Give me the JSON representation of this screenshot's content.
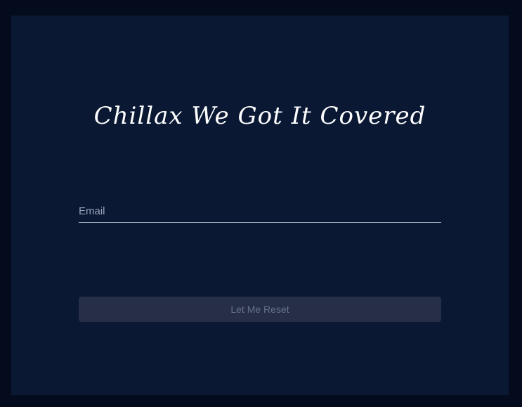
{
  "form": {
    "title": "Chillax We Got It Covered",
    "email_placeholder": "Email",
    "email_value": "",
    "submit_label": "Let Me Reset"
  },
  "colors": {
    "outer_background": "#030b1c",
    "panel_background": "#0a1834",
    "title_text": "#ffffff",
    "input_underline": "#9ba6bb",
    "button_background": "#262f46",
    "button_text": "#66708a"
  }
}
